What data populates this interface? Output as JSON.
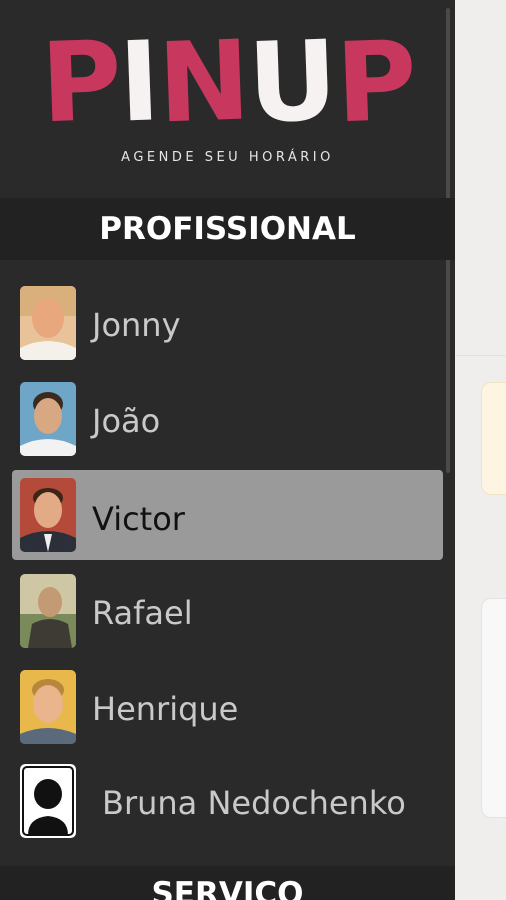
{
  "brand": {
    "logo_letters": [
      "P",
      "I",
      "N",
      "U",
      "P"
    ],
    "tagline": "AGENDE SEU HORÁRIO",
    "accent_color": "#c8385e"
  },
  "sections": {
    "professional_title": "PROFISSIONAL",
    "service_title": "SERVIÇO"
  },
  "professionals": [
    {
      "name": "Jonny",
      "selected": false,
      "avatar": "photo-bald-man"
    },
    {
      "name": "João",
      "selected": false,
      "avatar": "photo-young-man"
    },
    {
      "name": "Victor",
      "selected": true,
      "avatar": "photo-man-suit"
    },
    {
      "name": "Rafael",
      "selected": false,
      "avatar": "photo-man-outdoor"
    },
    {
      "name": "Henrique",
      "selected": false,
      "avatar": "photo-blond-man"
    },
    {
      "name": "Bruna Nedochenko",
      "selected": false,
      "avatar": "placeholder-person-icon"
    }
  ]
}
